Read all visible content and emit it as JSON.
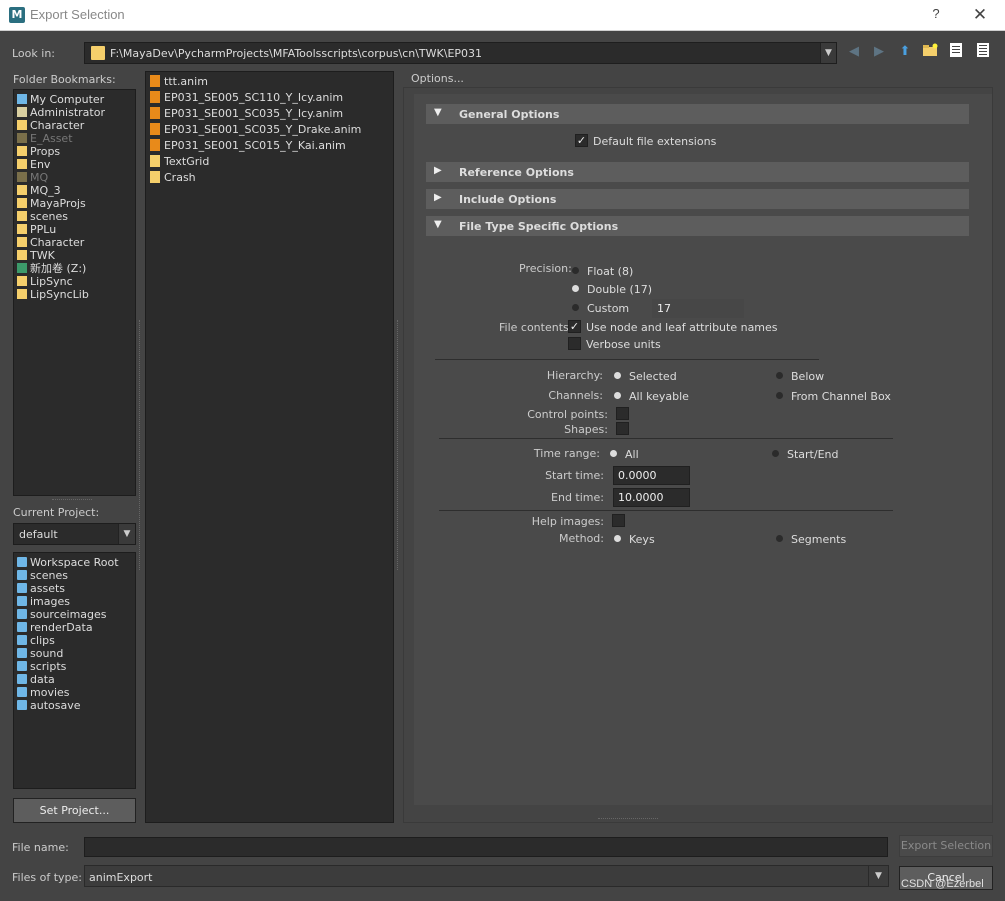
{
  "window": {
    "title": "Export Selection",
    "app_icon_letter": "M",
    "help_label": "?",
    "close_label": "✕"
  },
  "lookin": {
    "label": "Look in:",
    "path": "F:\\MayaDev\\PycharmProjects\\MFAToolsscripts\\corpus\\cn\\TWK\\EP031"
  },
  "bookmarks": {
    "label": "Folder Bookmarks:",
    "items": [
      {
        "label": "My Computer",
        "icon": "computer-icon"
      },
      {
        "label": "Administrator",
        "icon": "user-icon"
      },
      {
        "label": "Character",
        "icon": "folder-icon"
      },
      {
        "label": "E_Asset",
        "icon": "folder-icon",
        "dim": true
      },
      {
        "label": "Props",
        "icon": "folder-icon"
      },
      {
        "label": "Env",
        "icon": "folder-icon"
      },
      {
        "label": "MQ",
        "icon": "folder-icon",
        "dim": true
      },
      {
        "label": "MQ_3",
        "icon": "folder-icon"
      },
      {
        "label": "MayaProjs",
        "icon": "folder-icon"
      },
      {
        "label": "scenes",
        "icon": "folder-icon"
      },
      {
        "label": "PPLu",
        "icon": "folder-icon"
      },
      {
        "label": "Character",
        "icon": "folder-icon"
      },
      {
        "label": "TWK",
        "icon": "folder-icon"
      },
      {
        "label": "新加卷 (Z:)",
        "icon": "network-drive-icon"
      },
      {
        "label": "LipSync",
        "icon": "folder-icon"
      },
      {
        "label": "LipSyncLib",
        "icon": "folder-icon"
      }
    ]
  },
  "project": {
    "label": "Current Project:",
    "value": "default",
    "items": [
      "Workspace Root",
      "scenes",
      "assets",
      "images",
      "sourceimages",
      "renderData",
      "clips",
      "sound",
      "scripts",
      "data",
      "movies",
      "autosave"
    ],
    "set_button": "Set Project..."
  },
  "files": [
    {
      "name": "ttt.anim",
      "type": "anim"
    },
    {
      "name": "EP031_SE005_SC110_Y_Icy.anim",
      "type": "anim"
    },
    {
      "name": "EP031_SE001_SC035_Y_Icy.anim",
      "type": "anim"
    },
    {
      "name": "EP031_SE001_SC035_Y_Drake.anim",
      "type": "anim"
    },
    {
      "name": "EP031_SE001_SC015_Y_Kai.anim",
      "type": "anim"
    },
    {
      "name": "TextGrid",
      "type": "folder"
    },
    {
      "name": "Crash",
      "type": "folder"
    }
  ],
  "options": {
    "label": "Options...",
    "general": {
      "title": "General Options",
      "default_ext_label": "Default file extensions",
      "default_ext_checked": true
    },
    "reference": {
      "title": "Reference Options"
    },
    "include": {
      "title": "Include Options"
    },
    "filetype": {
      "title": "File Type Specific Options",
      "precision_label": "Precision:",
      "float_label": "Float (8)",
      "double_label": "Double (17)",
      "custom_label": "Custom",
      "custom_value": "17",
      "file_contents_label": "File contents:",
      "use_node_label": "Use node and leaf attribute names",
      "verbose_label": "Verbose units",
      "hierarchy_label": "Hierarchy:",
      "selected_label": "Selected",
      "below_label": "Below",
      "channels_label": "Channels:",
      "all_keyable_label": "All keyable",
      "from_cb_label": "From Channel Box",
      "control_points_label": "Control points:",
      "shapes_label": "Shapes:",
      "time_range_label": "Time range:",
      "all_label": "All",
      "start_end_label": "Start/End",
      "start_time_label": "Start time:",
      "start_time_value": "0.0000",
      "end_time_label": "End time:",
      "end_time_value": "10.0000",
      "help_images_label": "Help images:",
      "method_label": "Method:",
      "keys_label": "Keys",
      "segments_label": "Segments"
    }
  },
  "bottom": {
    "file_name_label": "File name:",
    "file_name_value": "",
    "export_button": "Export Selection",
    "file_type_label": "Files of type:",
    "file_type_value": "animExport",
    "cancel_button": "Cancel",
    "watermark": "CSDN @Ezerbel"
  }
}
